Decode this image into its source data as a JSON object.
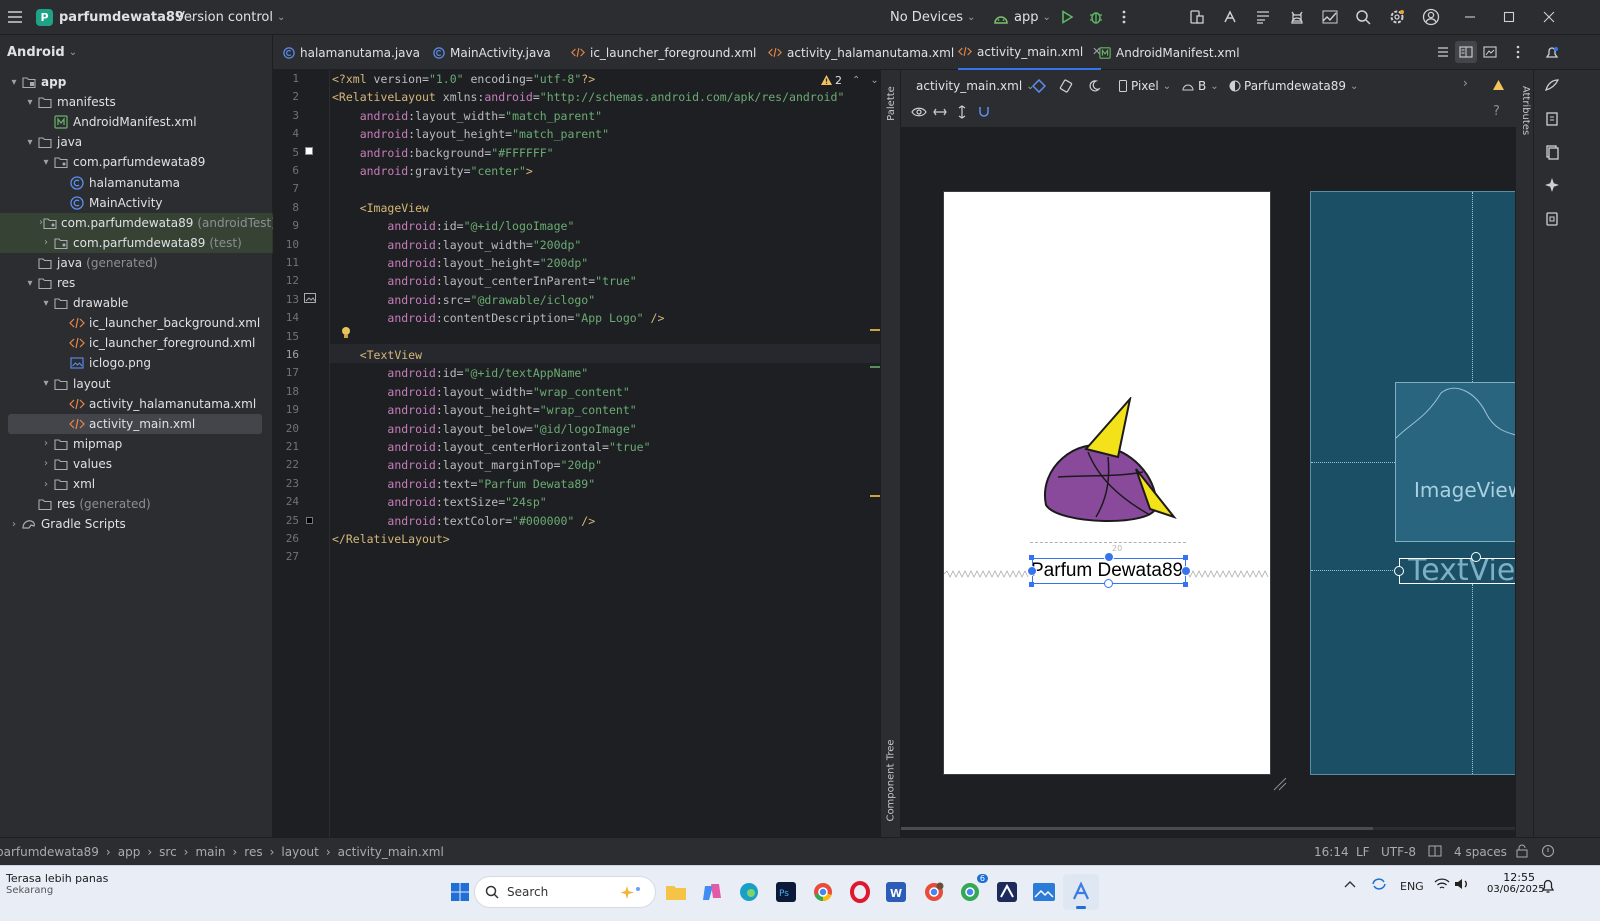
{
  "titlebar": {
    "project_letter": "P",
    "project_name": "parfumdewata89",
    "vcs": "Version control",
    "devices": "No Devices",
    "run_config": "app"
  },
  "project_pane": {
    "view_mode": "Android",
    "items": [
      {
        "label": "app",
        "suffix": "",
        "depth": 0,
        "arrow": "▾",
        "icon": "module-folder-icon",
        "bold": true
      },
      {
        "label": "manifests",
        "suffix": "",
        "depth": 1,
        "arrow": "▾",
        "icon": "folder-icon"
      },
      {
        "label": "AndroidManifest.xml",
        "suffix": "",
        "depth": 2,
        "arrow": "",
        "icon": "manifest-file-icon"
      },
      {
        "label": "java",
        "suffix": "",
        "depth": 1,
        "arrow": "▾",
        "icon": "folder-icon"
      },
      {
        "label": "com.parfumdewata89",
        "suffix": "",
        "depth": 2,
        "arrow": "▾",
        "icon": "package-icon"
      },
      {
        "label": "halamanutama",
        "suffix": "",
        "depth": 3,
        "arrow": "",
        "icon": "class-icon"
      },
      {
        "label": "MainActivity",
        "suffix": "",
        "depth": 3,
        "arrow": "",
        "icon": "class-icon"
      },
      {
        "label": "com.parfumdewata89",
        "suffix": "(androidTest)",
        "depth": 2,
        "arrow": "›",
        "icon": "package-icon",
        "green": true
      },
      {
        "label": "com.parfumdewata89",
        "suffix": "(test)",
        "depth": 2,
        "arrow": "›",
        "icon": "package-icon",
        "green": true
      },
      {
        "label": "java",
        "suffix": "(generated)",
        "depth": 1,
        "arrow": "",
        "icon": "folder-icon",
        "dim": true
      },
      {
        "label": "res",
        "suffix": "",
        "depth": 1,
        "arrow": "▾",
        "icon": "folder-icon"
      },
      {
        "label": "drawable",
        "suffix": "",
        "depth": 2,
        "arrow": "▾",
        "icon": "folder-icon"
      },
      {
        "label": "ic_launcher_background.xml",
        "suffix": "",
        "depth": 3,
        "arrow": "",
        "icon": "xml-file-icon"
      },
      {
        "label": "ic_launcher_foreground.xml",
        "suffix": "",
        "depth": 3,
        "arrow": "",
        "icon": "xml-file-icon"
      },
      {
        "label": "iclogo.png",
        "suffix": "",
        "depth": 3,
        "arrow": "",
        "icon": "image-file-icon"
      },
      {
        "label": "layout",
        "suffix": "",
        "depth": 2,
        "arrow": "▾",
        "icon": "folder-icon"
      },
      {
        "label": "activity_halamanutama.xml",
        "suffix": "",
        "depth": 3,
        "arrow": "",
        "icon": "xml-file-icon"
      },
      {
        "label": "activity_main.xml",
        "suffix": "",
        "depth": 3,
        "arrow": "",
        "icon": "xml-file-icon",
        "selected": true
      },
      {
        "label": "mipmap",
        "suffix": "",
        "depth": 2,
        "arrow": "›",
        "icon": "folder-icon"
      },
      {
        "label": "values",
        "suffix": "",
        "depth": 2,
        "arrow": "›",
        "icon": "folder-icon"
      },
      {
        "label": "xml",
        "suffix": "",
        "depth": 2,
        "arrow": "›",
        "icon": "folder-icon"
      },
      {
        "label": "res",
        "suffix": "(generated)",
        "depth": 1,
        "arrow": "",
        "icon": "folder-icon",
        "dim": true
      },
      {
        "label": "Gradle Scripts",
        "suffix": "",
        "depth": 0,
        "arrow": "›",
        "icon": "gradle-icon"
      }
    ]
  },
  "tabs": [
    {
      "label": "halamanutama.java",
      "icon": "class-icon"
    },
    {
      "label": "MainActivity.java",
      "icon": "class-icon"
    },
    {
      "label": "ic_launcher_foreground.xml",
      "icon": "xml-file-icon"
    },
    {
      "label": "activity_halamanutama.xml",
      "icon": "xml-file-icon"
    },
    {
      "label": "activity_main.xml",
      "icon": "xml-file-icon",
      "active": true
    },
    {
      "label": "AndroidManifest.xml",
      "icon": "manifest-file-icon"
    }
  ],
  "editor": {
    "warning_count": "2",
    "line_numbers": [
      "1",
      "2",
      "3",
      "4",
      "5",
      "6",
      "7",
      "8",
      "9",
      "10",
      "11",
      "12",
      "13",
      "14",
      "15",
      "16",
      "17",
      "18",
      "19",
      "20",
      "21",
      "22",
      "23",
      "24",
      "25",
      "26",
      "27"
    ],
    "lines": [
      "<?xml version=\"1.0\" encoding=\"utf-8\"?>",
      "<RelativeLayout xmlns:android=\"http://schemas.android.com/apk/res/android\"",
      "    android:layout_width=\"match_parent\"",
      "    android:layout_height=\"match_parent\"",
      "    android:background=\"#FFFFFF\"",
      "    android:gravity=\"center\">",
      "",
      "    <ImageView",
      "        android:id=\"@+id/logoImage\"",
      "        android:layout_width=\"200dp\"",
      "        android:layout_height=\"200dp\"",
      "        android:layout_centerInParent=\"true\"",
      "        android:src=\"@drawable/iclogo\"",
      "        android:contentDescription=\"App Logo\" />",
      "",
      "    <TextView",
      "        android:id=\"@+id/textAppName\"",
      "        android:layout_width=\"wrap_content\"",
      "        android:layout_height=\"wrap_content\"",
      "        android:layout_below=\"@id/logoImage\"",
      "        android:layout_centerHorizontal=\"true\"",
      "        android:layout_marginTop=\"20dp\"",
      "        android:text=\"Parfum Dewata89\"",
      "        android:textSize=\"24sp\"",
      "        android:textColor=\"#000000\" />",
      "</RelativeLayout>",
      ""
    ]
  },
  "design": {
    "file_dropdown": "activity_main.xml",
    "device": "Pixel",
    "api": "B",
    "theme": "Parfumdewata89",
    "palette_label": "Palette",
    "component_tree_label": "Component Tree",
    "attributes_label": "Attributes",
    "preview_text": "Parfum Dewata89",
    "blueprint_image_label": "ImageView",
    "blueprint_text_label": "TextView",
    "margin_label": "20"
  },
  "statusbar": {
    "crumbs": [
      "parfumdewata89",
      "app",
      "src",
      "main",
      "res",
      "layout",
      "activity_main.xml"
    ],
    "position": "16:14",
    "line_sep": "LF",
    "encoding": "UTF-8",
    "indent": "4 spaces"
  },
  "taskbar": {
    "weather_title": "Terasa lebih panas",
    "weather_sub": "Sekarang",
    "search_placeholder": "Search",
    "lang": "ENG",
    "time": "12:55",
    "date": "03/06/2025",
    "chrome_badge": "6"
  },
  "colors": {
    "accent": "#3574f0",
    "logo_purple": "#8a4a9c",
    "logo_yellow": "#f3e219",
    "blueprint": "#1b4f66"
  }
}
